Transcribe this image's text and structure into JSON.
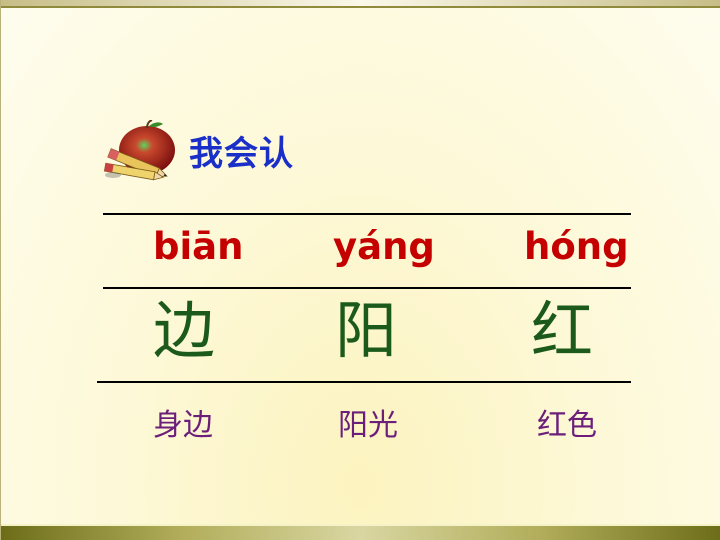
{
  "heading": "我会认",
  "icon": "apple-pencil-icon",
  "columns": [
    {
      "pinyin": "biān",
      "hanzi": "边",
      "word": "身边"
    },
    {
      "pinyin": "yáng",
      "hanzi": "阳",
      "word": "阳光"
    },
    {
      "pinyin": "hóng",
      "hanzi": "红",
      "word": "红色"
    }
  ],
  "colors": {
    "heading": "#1a2fc7",
    "pinyin": "#c40000",
    "hanzi": "#1b5a1b",
    "word": "#6b1f7a"
  }
}
